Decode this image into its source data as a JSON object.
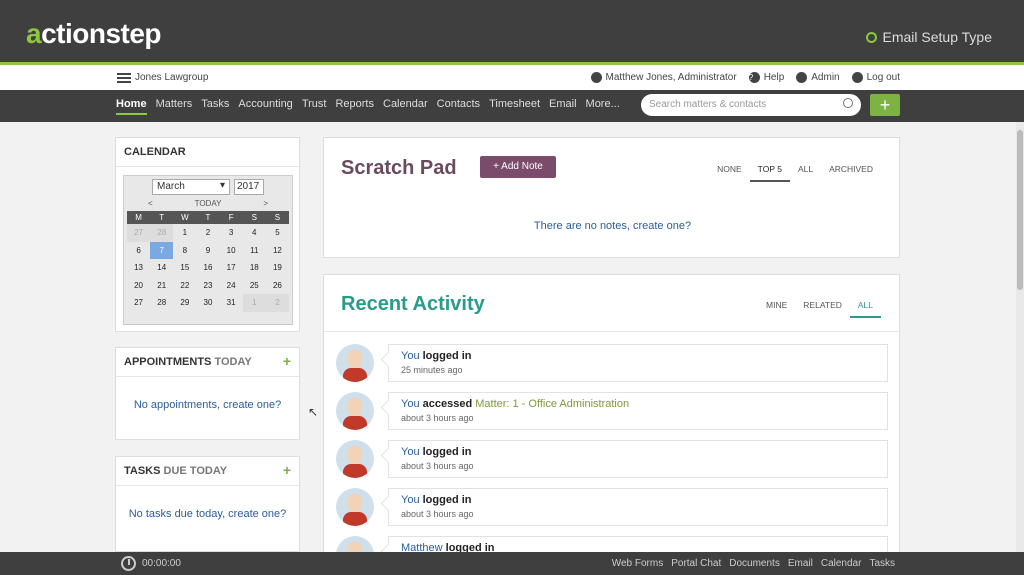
{
  "header": {
    "logo_prefix": "a",
    "logo_rest": "ctionstep",
    "setup_label": "Email Setup Type"
  },
  "userbar": {
    "firm": "Jones Lawgroup",
    "user": "Matthew Jones, Administrator",
    "help": "Help",
    "admin": "Admin",
    "logout": "Log out"
  },
  "nav": {
    "items": [
      "Home",
      "Matters",
      "Tasks",
      "Accounting",
      "Trust",
      "Reports",
      "Calendar",
      "Contacts",
      "Timesheet",
      "Email",
      "More..."
    ],
    "search_placeholder": "Search matters & contacts",
    "add": "+"
  },
  "calendar": {
    "title": "Calendar",
    "month": "March",
    "year": "2017",
    "prev": "<",
    "today": "TODAY",
    "next": ">",
    "weekdays": [
      "M",
      "T",
      "W",
      "T",
      "F",
      "S",
      "S"
    ],
    "weeks": [
      [
        "27",
        "28",
        "1",
        "2",
        "3",
        "4",
        "5"
      ],
      [
        "6",
        "7",
        "8",
        "9",
        "10",
        "11",
        "12"
      ],
      [
        "13",
        "14",
        "15",
        "16",
        "17",
        "18",
        "19"
      ],
      [
        "20",
        "21",
        "22",
        "23",
        "24",
        "25",
        "26"
      ],
      [
        "27",
        "28",
        "29",
        "30",
        "31",
        "1",
        "2"
      ]
    ],
    "selected": "7"
  },
  "appointments": {
    "title_bold": "Appointments",
    "title_light": "Today",
    "add": "+",
    "empty": "No appointments, create one?"
  },
  "tasks": {
    "title_bold": "Tasks",
    "title_light": "Due Today",
    "add": "+",
    "empty": "No tasks due today, create one?"
  },
  "scratch": {
    "title": "Scratch Pad",
    "add_note": "+ Add Note",
    "tabs": [
      "NONE",
      "TOP 5",
      "ALL",
      "ARCHIVED"
    ],
    "active_tab": "TOP 5",
    "empty": "There are no notes, create one?"
  },
  "recent": {
    "title": "Recent Activity",
    "tabs": [
      "MINE",
      "RELATED",
      "ALL"
    ],
    "active_tab": "ALL",
    "items": [
      {
        "who": "You",
        "action": "logged in",
        "object": "",
        "time": "25 minutes ago"
      },
      {
        "who": "You",
        "action": "accessed",
        "object": "Matter: 1 - Office Administration",
        "time": "about 3 hours ago"
      },
      {
        "who": "You",
        "action": "logged in",
        "object": "",
        "time": "about 3 hours ago"
      },
      {
        "who": "You",
        "action": "logged in",
        "object": "",
        "time": "about 3 hours ago"
      },
      {
        "who": "Matthew",
        "action": "logged in",
        "object": "",
        "time": ""
      }
    ]
  },
  "footer": {
    "timer": "00:00:00",
    "links": [
      "Web Forms",
      "Portal Chat",
      "Documents",
      "Email",
      "Calendar",
      "Tasks"
    ]
  }
}
